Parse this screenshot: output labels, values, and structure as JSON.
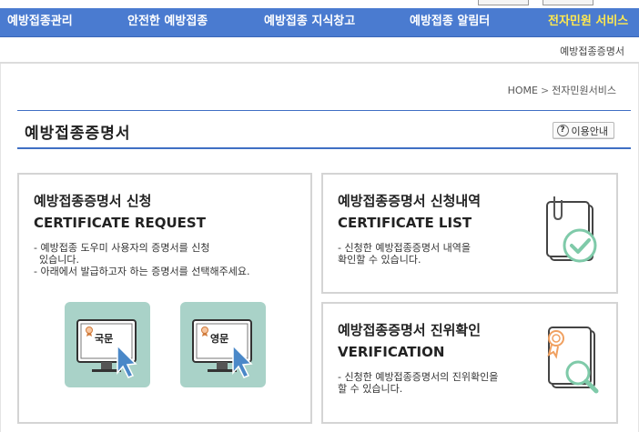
{
  "top_nav": {
    "items": [
      {
        "label": "예방접종관리",
        "active": false
      },
      {
        "label": "안전한 예방접종",
        "active": false
      },
      {
        "label": "예방접종 지식창고",
        "active": false
      },
      {
        "label": "예방접종 알림터",
        "active": false
      },
      {
        "label": "전자민원 서비스",
        "active": true
      }
    ]
  },
  "sub_nav": {
    "current": "예방접종증명서"
  },
  "breadcrumb": {
    "home": "HOME",
    "separator": ">",
    "section": "전자민원서비스"
  },
  "page": {
    "title": "예방접종증명서",
    "help_button": "이용안내"
  },
  "cards": {
    "request": {
      "title_kr": "예방접종증명서 신청",
      "title_en": "CERTIFICATE REQUEST",
      "desc": [
        "- 예방접종 도우미 사용자의 증명서를 신청",
        "  있습니다.",
        "- 아래에서 발급하고자 하는 증명서를 선택해주세요."
      ],
      "buttons": [
        {
          "label": "국문"
        },
        {
          "label": "영문"
        }
      ]
    },
    "list": {
      "title_kr": "예방접종증명서 신청내역",
      "title_en": "CERTIFICATE LIST",
      "desc": [
        "- 신청한 예방접종증명서 내역을",
        "   확인할 수 있습니다."
      ]
    },
    "verify": {
      "title_kr": "예방접종증명서 진위확인",
      "title_en": "VERIFICATION",
      "desc": [
        "- 신청한 예방접종증명서의 진위확인을",
        "   할 수 있습니다."
      ]
    }
  },
  "colors": {
    "nav_bg": "#4a7bd0",
    "nav_active": "#ffe94f",
    "title_rule": "#3f6fc4",
    "issue_button_bg": "#a9d2c8",
    "check_green": "#7fcaa9",
    "award_orange": "#f0a060"
  },
  "icons": {
    "help": "question-circle-icon",
    "list_card": "document-check-icon",
    "verify_card": "document-magnifier-icon",
    "issue_button": "monitor-cursor-icon"
  }
}
